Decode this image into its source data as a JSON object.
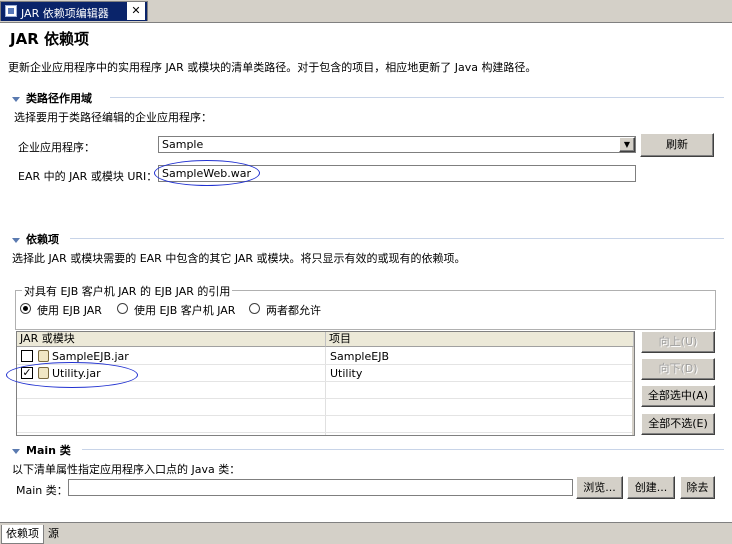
{
  "tab": {
    "label": "JAR 依赖项编辑器",
    "close": "✕"
  },
  "page": {
    "title": "JAR 依赖项",
    "description": "更新企业应用程序中的实用程序 JAR 或模块的清单类路径。对于包含的项目，相应地更新了 Java 构建路径。"
  },
  "classpath_scope": {
    "heading": "类路径作用域",
    "instruction": "选择要用于类路径编辑的企业应用程序：",
    "ear_label": "企业应用程序：",
    "ear_value": "Sample",
    "refresh_button": "刷新",
    "uri_label": "EAR 中的 JAR 或模块 URI：",
    "uri_value": "SampleWeb.war"
  },
  "dependencies": {
    "heading": "依赖项",
    "instruction": "选择此 JAR 或模块需要的 EAR 中包含的其它 JAR 或模块。将只显示有效的或现有的依赖项。",
    "group_label": "对具有 EJB 客户机 JAR 的 EJB JAR 的引用",
    "radios": [
      {
        "label": "使用 EJB JAR",
        "selected": true
      },
      {
        "label": "使用 EJB 客户机 JAR",
        "selected": false
      },
      {
        "label": "两者都允许",
        "selected": false
      }
    ],
    "columns": [
      "JAR 或模块",
      "项目"
    ],
    "rows": [
      {
        "jar": "SampleEJB.jar",
        "project": "SampleEJB",
        "checked": false
      },
      {
        "jar": "Utility.jar",
        "project": "Utility",
        "checked": true
      }
    ],
    "buttons": {
      "up": "向上(U)",
      "down": "向下(D)",
      "select_all": "全部选中(A)",
      "deselect_all": "全部不选(E)"
    }
  },
  "main_class": {
    "heading": "Main 类",
    "instruction": "以下清单属性指定应用程序入口点的 Java 类：",
    "label": "Main 类：",
    "value": "",
    "browse_button": "浏览...",
    "create_button": "创建...",
    "remove_button": "除去"
  },
  "bottom_tabs": [
    "依赖项",
    "源"
  ],
  "colors": {
    "active_tab_bg": "#0a246a",
    "section_separator": "#c8d4e8",
    "annotation_ellipse": "#2030d0",
    "button_face": "#d4d0c8"
  }
}
